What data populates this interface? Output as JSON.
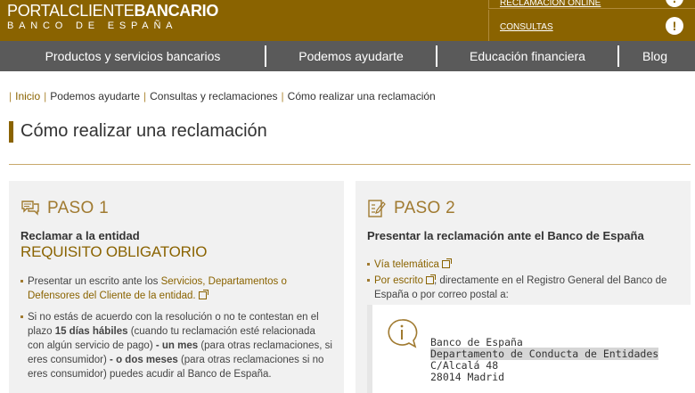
{
  "header": {
    "logo_light": "PORTAL",
    "logo_mid": "CLIENTE",
    "logo_bold": "BANCARIO",
    "logo_sub": "BANCO DE ESPAÑA",
    "link_reclamacion": "RECLAMACIÓN ONLINE",
    "link_consultas": "CONSULTAS",
    "alert_glyph": "!",
    "brand_color": "#8a6300"
  },
  "nav": {
    "items": [
      "Productos y servicios bancarios",
      "Podemos ayudarte",
      "Educación financiera",
      "Blog"
    ]
  },
  "breadcrumb": {
    "items": [
      "Inicio",
      "Podemos ayudarte",
      "Consultas y reclamaciones",
      "Cómo realizar una reclamación"
    ]
  },
  "page": {
    "title": "Cómo realizar una reclamación"
  },
  "step1": {
    "label": "PASO 1",
    "subtitle": "Reclamar a la entidad",
    "requirement": "REQUISITO OBLIGATORIO",
    "b1_pre": "Presentar un escrito ante los ",
    "b1_link": "Servicios, Departamentos o Defensores del Cliente de la entidad.",
    "b2_pre": "Si no estás de acuerdo con la resolución o no te contestan en el plazo ",
    "b2_bold1": "15 días hábiles",
    "b2_mid1": " (cuando tu reclamación esté relacionada con algún servicio de pago) ",
    "b2_bold2": "- un mes",
    "b2_mid2": " (para otras reclamaciones, si eres consumidor) ",
    "b2_bold3": "- o dos meses",
    "b2_post": " (para otras reclamaciones si no eres consumidor) puedes acudir al Banco de España."
  },
  "step2": {
    "label": "PASO 2",
    "subtitle": "Presentar la reclamación ante el Banco de España",
    "b1_link": "Vía telemática",
    "b2_link": "Por escrito",
    "b2_post": ", directamente en el Registro General del Banco de España o por correo postal a:",
    "address": {
      "line1": "Banco de España",
      "line2": "Departamento de Conducta de Entidades",
      "line3": "C/Alcalá 48",
      "line4": "28014 Madrid"
    }
  }
}
